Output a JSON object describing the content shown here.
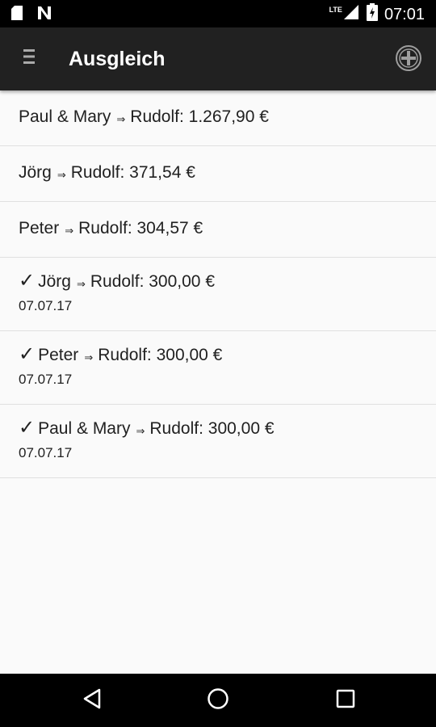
{
  "status_bar": {
    "time": "07:01",
    "network": "LTE",
    "icons": [
      "sd-card-icon",
      "notification-n-icon",
      "signal-icon",
      "battery-charging-icon"
    ]
  },
  "app_bar": {
    "title": "Ausgleich",
    "menu_icon": "menu-icon",
    "action_icon": "add-circle-icon"
  },
  "settlements": [
    {
      "from": "Paul & Mary",
      "arrow": "⇒",
      "to": "Rudolf",
      "amount": "1.267,90 €",
      "done": false,
      "date": ""
    },
    {
      "from": "Jörg",
      "arrow": "⇒",
      "to": "Rudolf",
      "amount": "371,54 €",
      "done": false,
      "date": ""
    },
    {
      "from": "Peter",
      "arrow": "⇒",
      "to": "Rudolf",
      "amount": "304,57 €",
      "done": false,
      "date": ""
    },
    {
      "from": "Jörg",
      "arrow": "⇒",
      "to": "Rudolf",
      "amount": "300,00 €",
      "done": true,
      "check": "✓",
      "date": "07.07.17"
    },
    {
      "from": "Peter",
      "arrow": "⇒",
      "to": "Rudolf",
      "amount": "300,00 €",
      "done": true,
      "check": "✓",
      "date": "07.07.17"
    },
    {
      "from": "Paul & Mary",
      "arrow": "⇒",
      "to": "Rudolf",
      "amount": "300,00 €",
      "done": true,
      "check": "✓",
      "date": "07.07.17"
    }
  ],
  "nav_bar": {
    "icons": [
      "back-icon",
      "home-icon",
      "recents-icon"
    ]
  },
  "colors": {
    "app_bar": "#212121",
    "background": "#fafafa",
    "divider": "#e0e0e0",
    "text": "#212121"
  }
}
